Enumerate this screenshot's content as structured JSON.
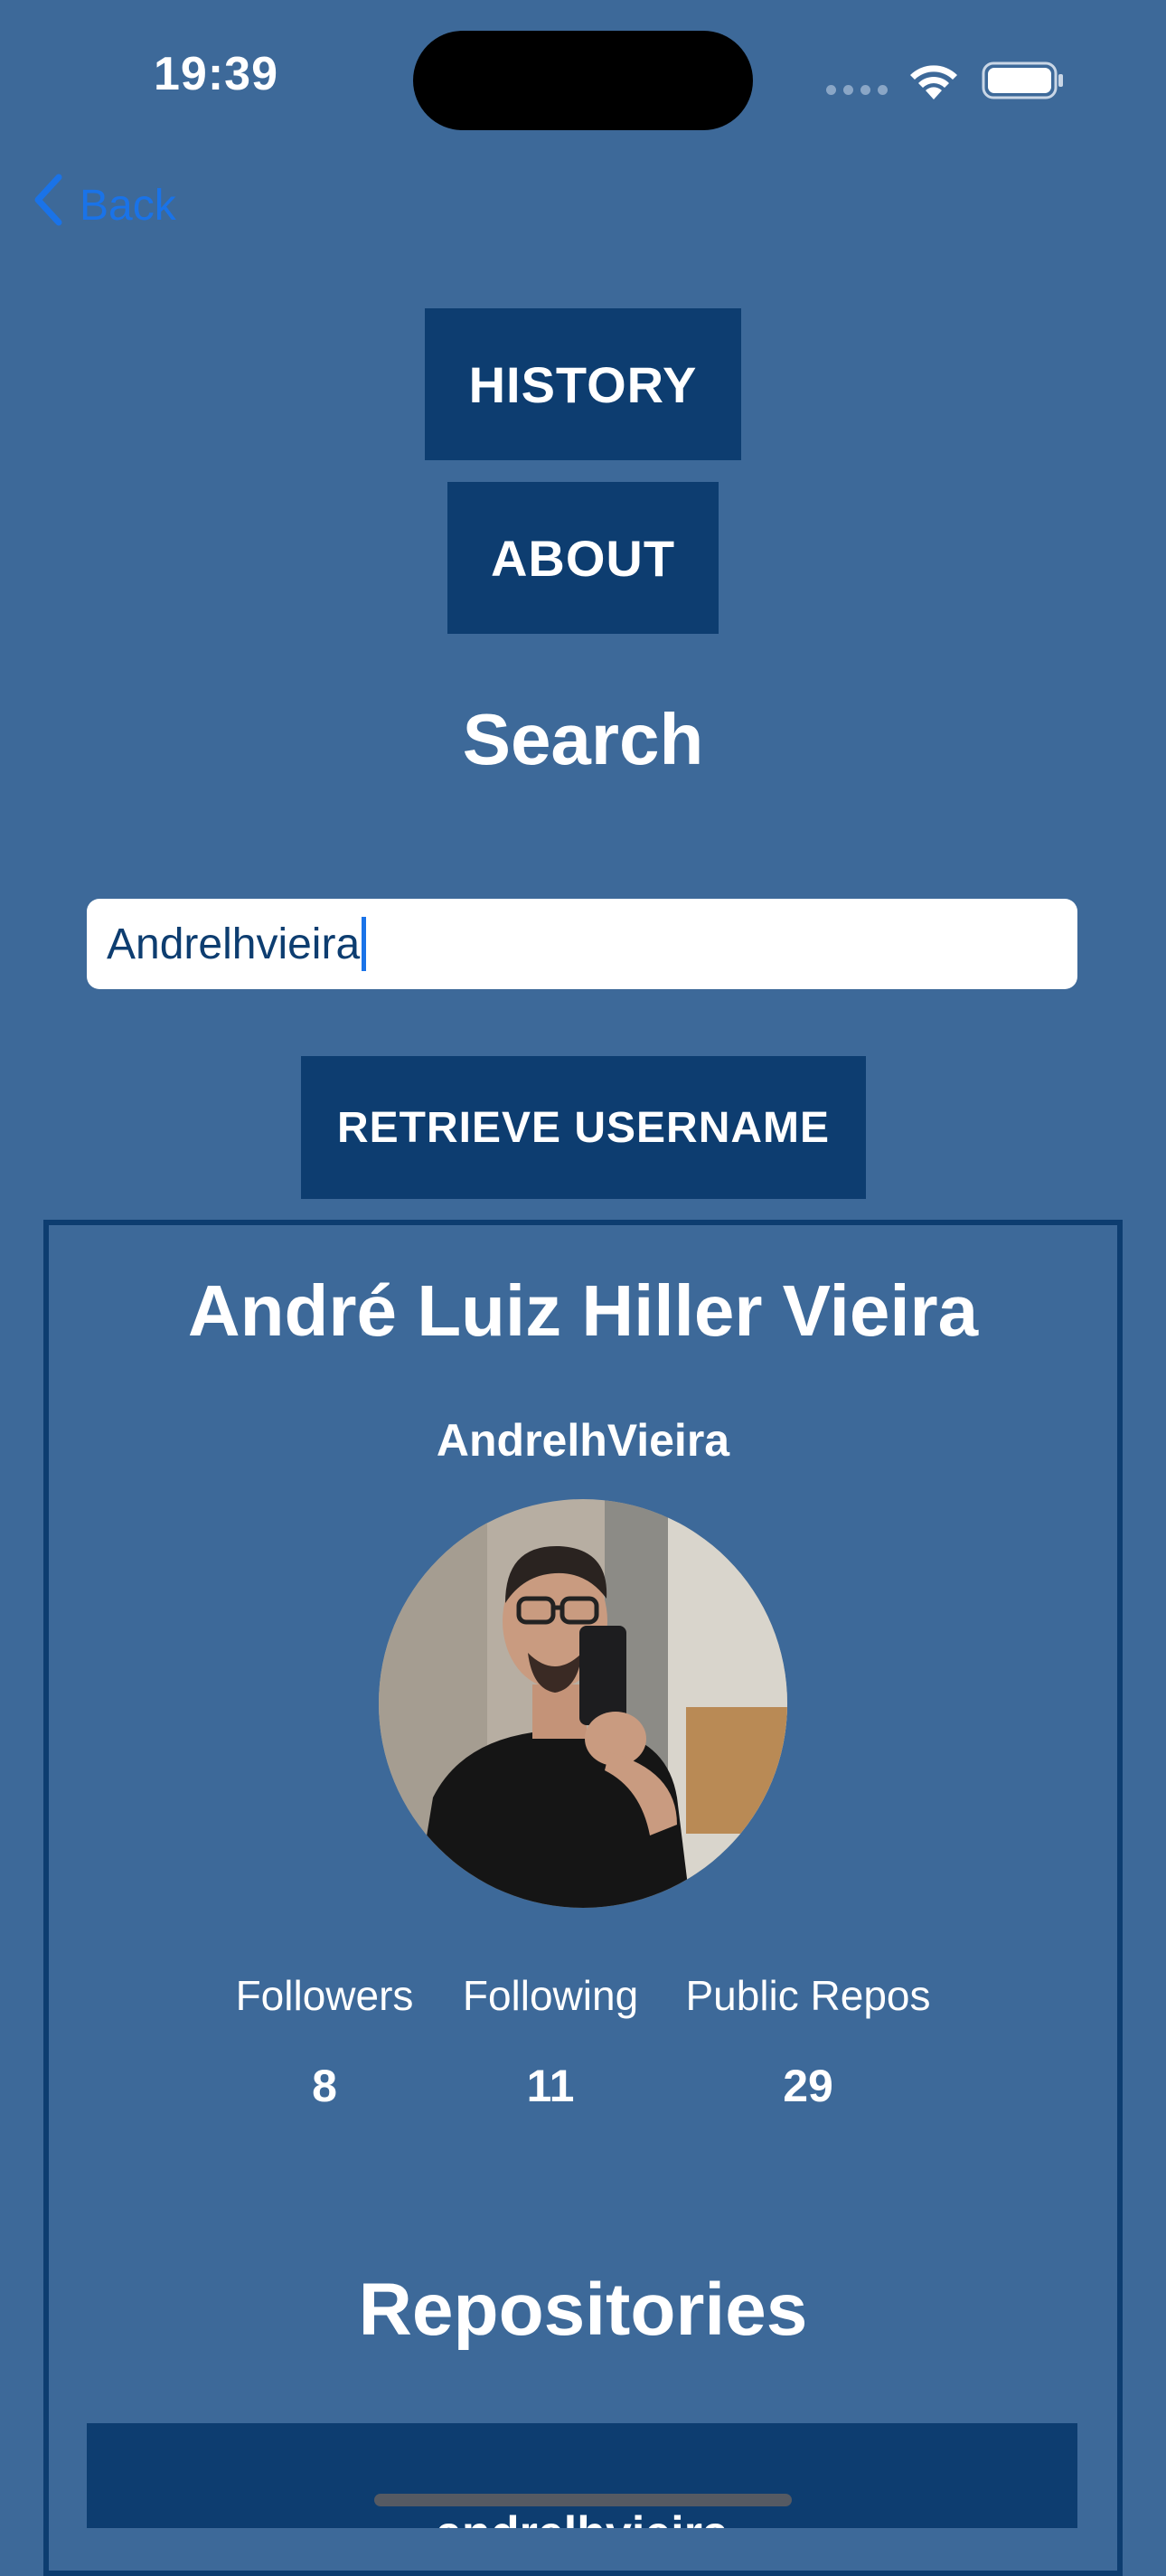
{
  "status_bar": {
    "time": "19:39"
  },
  "nav": {
    "back_label": "Back"
  },
  "buttons": {
    "history": "HISTORY",
    "about": "ABOUT",
    "retrieve": "RETRIEVE USERNAME"
  },
  "search": {
    "title": "Search",
    "value": "Andrelhvieira"
  },
  "profile": {
    "full_name": "André Luiz Hiller Vieira",
    "login": "AndrelhVieira",
    "stats": [
      {
        "label": "Followers",
        "value": "8"
      },
      {
        "label": "Following",
        "value": "11"
      },
      {
        "label": "Public Repos",
        "value": "29"
      }
    ]
  },
  "repositories": {
    "title": "Repositories",
    "items": [
      {
        "name": "andrelhvieira"
      }
    ]
  },
  "colors": {
    "background": "#3d6999",
    "button": "#0d3d70",
    "accent": "#1a73e8"
  }
}
